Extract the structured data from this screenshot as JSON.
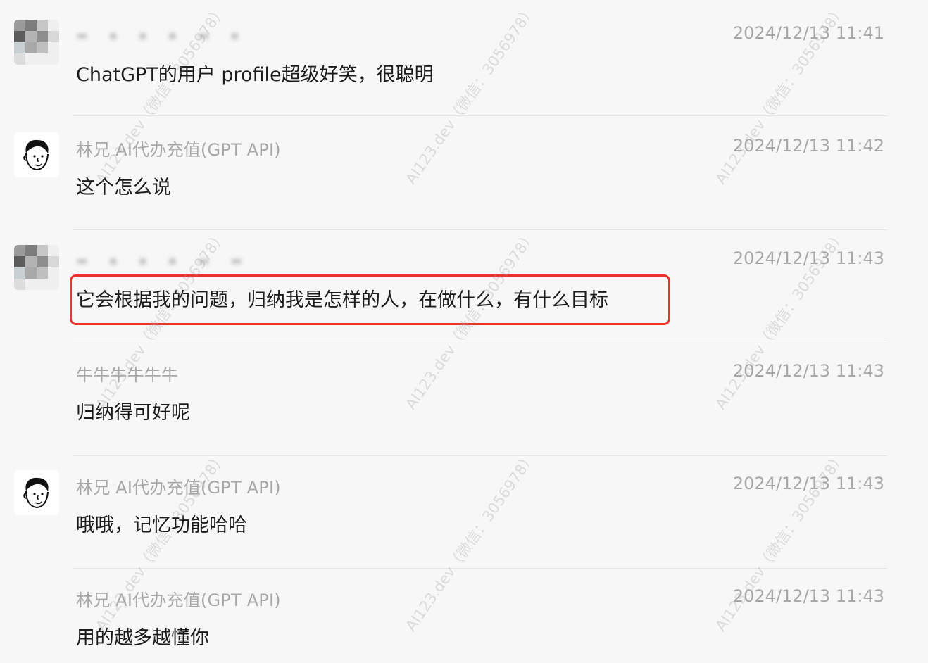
{
  "messages": [
    {
      "sender": "▬ ▪ ▪ ▪ ▬ ▪",
      "sender_blurred": true,
      "time": "2024/12/13 11:41",
      "text": "ChatGPT的用户 profile超级好笑，很聪明",
      "avatar": "pixelated"
    },
    {
      "sender": "林兄 AI代办充值(GPT API)",
      "sender_blurred": false,
      "time": "2024/12/13 11:42",
      "text": "这个怎么说",
      "avatar": "cartoon-face"
    },
    {
      "sender": "▬ ▪ ▪ ▪ ▬ ▬",
      "sender_blurred": true,
      "time": "2024/12/13 11:43",
      "text": "它会根据我的问题，归纳我是怎样的人，在做什么，有什么目标",
      "avatar": "pixelated"
    },
    {
      "sender": "牛牛牛牛牛牛",
      "sender_blurred": false,
      "time": "2024/12/13 11:43",
      "text": "归纳得可好呢",
      "avatar": "none"
    },
    {
      "sender": "林兄 AI代办充值(GPT API)",
      "sender_blurred": false,
      "time": "2024/12/13 11:43",
      "text": "哦哦，记忆功能哈哈",
      "avatar": "cartoon-face"
    },
    {
      "sender": "林兄 AI代办充值(GPT API)",
      "sender_blurred": false,
      "time": "2024/12/13 11:43",
      "text": "用的越多越懂你",
      "avatar": "none"
    }
  ],
  "watermark": "AI123.dev（微信：3056978）",
  "highlight_color": "#e8342a"
}
